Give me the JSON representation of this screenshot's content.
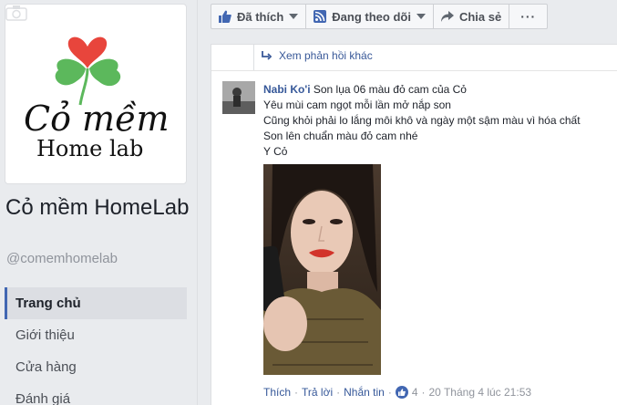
{
  "page": {
    "logo_text_1": "Cỏ mềm",
    "logo_text_2": "Home lab",
    "name": "Cỏ mềm HomeLab",
    "handle": "@comemhomelab"
  },
  "nav": {
    "items": [
      {
        "label": "Trang chủ",
        "active": true
      },
      {
        "label": "Giới thiệu",
        "active": false
      },
      {
        "label": "Cửa hàng",
        "active": false
      },
      {
        "label": "Đánh giá",
        "active": false
      }
    ]
  },
  "actions": {
    "liked_label": "Đã thích",
    "following_label": "Đang theo dõi",
    "share_label": "Chia sẻ",
    "more_label": "···"
  },
  "thread": {
    "more_replies": "Xem phản hồi khác"
  },
  "comment": {
    "author": "Nabi Ko'i",
    "line1": "Son lụa 06 màu đỏ cam của Cỏ",
    "line2": "Yêu mùi cam ngọt mỗi lần mở nắp son",
    "line3": "Cũng khỏi phải lo lắng môi khô và ngày một sậm màu vì hóa chất",
    "line4": "Son lên chuẩn màu đỏ cam nhé",
    "line5": "Y Cỏ",
    "like": "Thích",
    "reply": "Trả lời",
    "message": "Nhắn tin",
    "like_count": "4",
    "timestamp": "20 Tháng 4 lúc 21:53"
  },
  "colors": {
    "link_blue": "#365899",
    "fb_blue": "#4267b2",
    "logo_red": "#e8453c",
    "logo_green": "#5cb85c"
  },
  "icons": [
    "thumbs-up-icon",
    "rss-icon",
    "share-arrow-icon",
    "reply-arrow-icon",
    "camera-icon",
    "like-badge-icon"
  ]
}
